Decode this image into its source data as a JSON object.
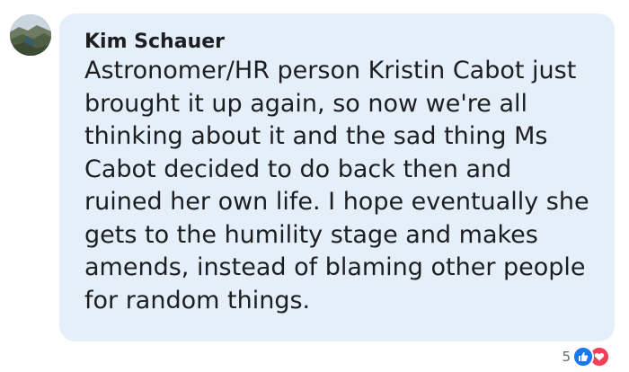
{
  "comment": {
    "author": "Kim Schauer",
    "text": "Astronomer/HR person Kristin Cabot just brought it up again, so now we're all thinking about it and the sad thing Ms Cabot decided to do back then and ruined her own life. I hope eventually she gets to the humility stage and makes amends, instead of blaming other people for random things.",
    "avatar_icon": "landscape-avatar",
    "bubble_color": "#e4effa"
  },
  "reactions": {
    "count": "5",
    "icons": [
      "like-icon",
      "love-icon"
    ],
    "like_color": "#1877f2",
    "love_color": "#f33e58"
  }
}
